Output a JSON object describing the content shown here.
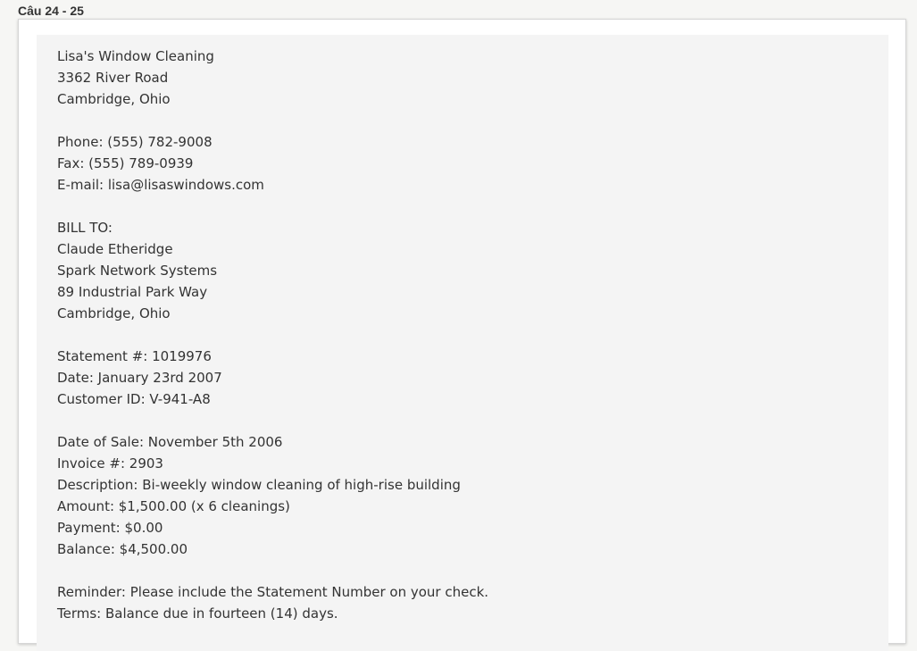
{
  "question_label": "Câu 24 - 25",
  "document": {
    "sender": {
      "name": "Lisa's Window Cleaning",
      "street": "3362 River Road",
      "city": "Cambridge, Ohio"
    },
    "contact": {
      "phone": "Phone: (555) 782-9008",
      "fax": "Fax: (555) 789-0939",
      "email": "E-mail: lisa@lisaswindows.com"
    },
    "bill_to": {
      "heading": "BILL TO:",
      "name": "Claude Etheridge",
      "company": "Spark Network Systems",
      "street": "89 Industrial Park Way",
      "city": "Cambridge, Ohio"
    },
    "statement": {
      "number": "Statement #: 1019976",
      "date": "Date: January 23rd 2007",
      "customer_id": "Customer ID: V-941-A8"
    },
    "sale": {
      "date_of_sale": "Date of Sale: November 5th 2006",
      "invoice": "Invoice #: 2903",
      "description": "Description: Bi-weekly window cleaning of high-rise building",
      "amount": "Amount: $1,500.00 (x 6 cleanings)",
      "payment": "Payment: $0.00",
      "balance": "Balance: $4,500.00"
    },
    "notes": {
      "reminder": "Reminder: Please include the Statement Number on your check.",
      "terms": "Terms: Balance due in fourteen (14) days."
    }
  }
}
